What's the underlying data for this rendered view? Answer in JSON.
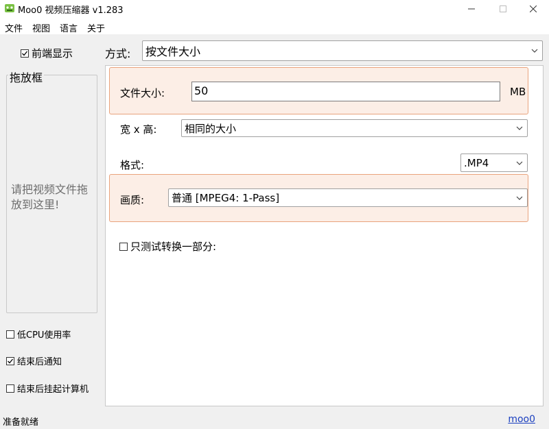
{
  "window": {
    "title": "Moo0 视频压缩器 v1.283",
    "minimize_icon": "minimize-icon",
    "maximize_icon": "maximize-icon",
    "close_icon": "close-icon"
  },
  "menu": {
    "file": "文件",
    "view": "视图",
    "language": "语言",
    "about": "关于"
  },
  "left": {
    "always_on_top": {
      "label": "前端显示",
      "checked": true
    },
    "drop_box_title": "拖放框",
    "drop_hint": "请把视频文件拖放到这里!",
    "low_cpu": {
      "label": "低CPU使用率",
      "checked": false
    },
    "notify_when_done": {
      "label": "结束后通知",
      "checked": true
    },
    "hibernate_when_done": {
      "label": "结束后挂起计算机",
      "checked": false
    }
  },
  "method": {
    "label": "方式:",
    "value": "按文件大小"
  },
  "settings": {
    "file_size_label": "文件大小:",
    "file_size_value": "50",
    "file_size_unit": "MB",
    "dimensions_label": "宽 x 高:",
    "dimensions_value": "相同的大小",
    "format_label": "格式:",
    "format_value": ".MP4",
    "quality_label": "画质:",
    "quality_value": "普通  [MPEG4: 1-Pass]",
    "test_part": {
      "label": "只测试转换一部分:",
      "checked": false
    }
  },
  "status": {
    "text": "准备就绪",
    "link": "moo0"
  },
  "colors": {
    "highlight_bg": "#fceee6",
    "highlight_border": "#e9a27c",
    "link": "#1a3fbf"
  }
}
